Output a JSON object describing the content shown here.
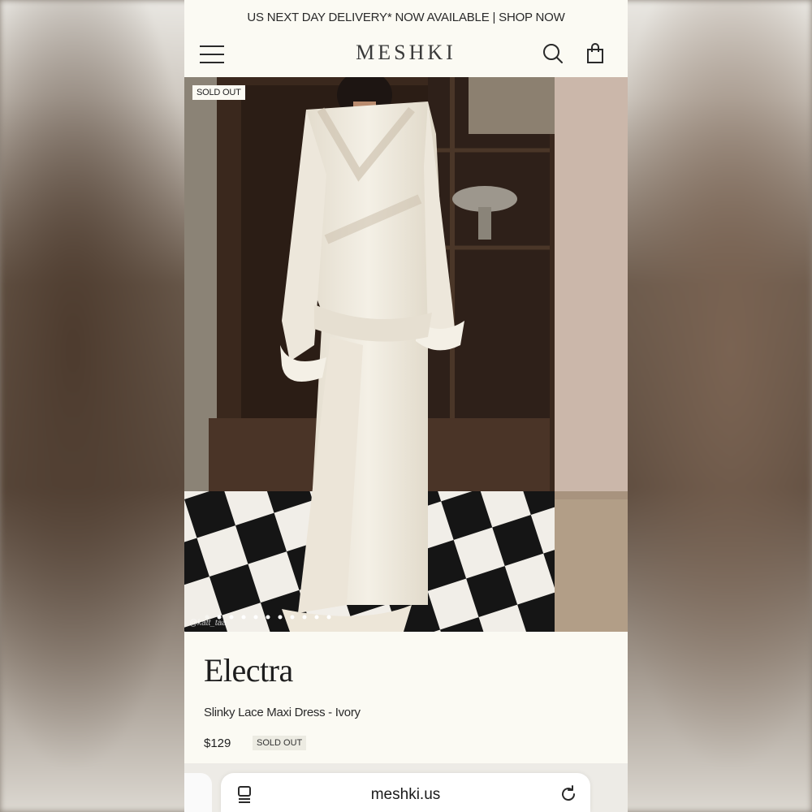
{
  "announcement": "US NEXT DAY DELIVERY* NOW AVAILABLE | SHOP NOW",
  "header": {
    "logo": "MESHKI",
    "icons": [
      "menu-icon",
      "search-icon",
      "shopping-bag-icon"
    ]
  },
  "gallery": {
    "sold_out_label": "SOLD OUT",
    "photo_credit": "@katt_taa",
    "slide_count": 11,
    "active_slide": 1
  },
  "product": {
    "name": "Electra",
    "subtitle": "Slinky Lace Maxi Dress - Ivory",
    "price": "$129",
    "status": "SOLD OUT"
  },
  "browser": {
    "url": "meshki.us",
    "icons": [
      "tabs-icon",
      "reload-icon"
    ]
  },
  "colors": {
    "page_background": "#fbfaf3",
    "text": "#1e1e1e",
    "badge_background": "#ecebe2"
  }
}
